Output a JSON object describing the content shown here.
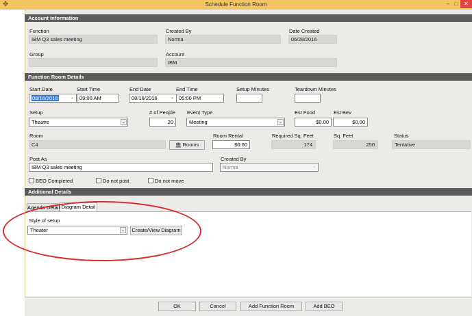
{
  "window": {
    "title": "Schedule Function Room",
    "minimize": "–",
    "maximize": "□",
    "close": "✕",
    "icon": "app-icon"
  },
  "account_info": {
    "header": "Account Information",
    "function_label": "Function",
    "function_value": "IBM Q3 sales meeting",
    "created_by_label": "Created By",
    "created_by_value": "Norma",
    "date_created_label": "Date Created",
    "date_created_value": "06/28/2016",
    "group_label": "Group",
    "group_value": "",
    "account_label": "Account",
    "account_value": "IBM"
  },
  "function_room": {
    "header": "Function Room Details",
    "start_date_label": "Start Date",
    "start_date_value": "08/16/2016",
    "start_time_label": "Start Time",
    "start_time_value": "09:00 AM",
    "end_date_label": "End Date",
    "end_date_value": "08/16/2016",
    "end_time_label": "End Time",
    "end_time_value": "05:00 PM",
    "setup_minutes_label": "Setup Minutes",
    "setup_minutes_value": "",
    "teardown_minutes_label": "Teardown Minutes",
    "teardown_minutes_value": "",
    "setup_label": "Setup",
    "setup_value": "Theatre",
    "people_label": "# of People",
    "people_value": "20",
    "event_type_label": "Event Type",
    "event_type_value": "Meeting",
    "est_food_label": "Est Food",
    "est_food_value": "$0.00",
    "est_bev_label": "Est Bev",
    "est_bev_value": "$0.00",
    "room_label": "Room",
    "room_value": "C4",
    "rooms_button": "Rooms",
    "room_rental_label": "Room Rental",
    "room_rental_value": "$0.00",
    "req_sqft_label": "Required Sq. Feet",
    "req_sqft_value": "174",
    "sqft_label": "Sq. Feet",
    "sqft_value": "250",
    "status_label": "Status",
    "status_value": "Tentative",
    "post_as_label": "Post As",
    "post_as_value": "IBM Q3 sales meeting",
    "created_by_label": "Created By",
    "created_by_value": "Norma",
    "beo_completed_label": "BEO Completed",
    "do_not_post_label": "Do not post",
    "do_not_move_label": "Do not move"
  },
  "additional": {
    "header": "Additional Details",
    "tabs": [
      {
        "label": "Agenda Detail"
      },
      {
        "label": "Diagram Detail"
      }
    ],
    "style_label": "Style of setup",
    "style_value": "Theater",
    "create_view_button": "Create/View Diagram"
  },
  "footer": {
    "ok": "OK",
    "cancel": "Cancel",
    "add_function_room": "Add Function Room",
    "add_beo": "Add BEO"
  },
  "colors": {
    "titlebar": "#f3c463",
    "section_header": "#5c5c5c",
    "annotation": "#d72a2a",
    "selection": "#3a7bd5"
  }
}
